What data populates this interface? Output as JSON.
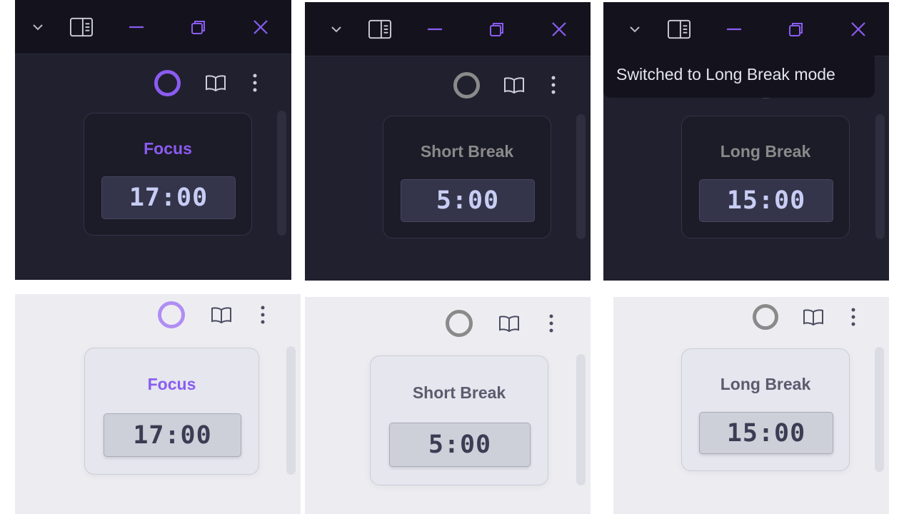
{
  "colors": {
    "accent_purple": "#8a5cf0",
    "inactive_gray": "#8a8a8a",
    "dark_bg": "#21202f",
    "light_bg": "#ededf1",
    "close_icon": "#8a5cf0"
  },
  "titlebar_icons": [
    "chevron-down-icon",
    "sidebar-toggle-icon",
    "minimize-icon",
    "restore-icon",
    "close-icon"
  ],
  "toolbar_icons": [
    "timer-ring-icon",
    "book-icon",
    "more-vertical-icon"
  ],
  "panels": [
    {
      "theme": "dark",
      "mode": "Focus",
      "time": "17:00",
      "active": true
    },
    {
      "theme": "dark",
      "mode": "Short Break",
      "time": "5:00",
      "active": false
    },
    {
      "theme": "dark",
      "mode": "Long Break",
      "time": "15:00",
      "active": false
    },
    {
      "theme": "light",
      "mode": "Focus",
      "time": "17:00",
      "active": true
    },
    {
      "theme": "light",
      "mode": "Short Break",
      "time": "5:00",
      "active": false
    },
    {
      "theme": "light",
      "mode": "Long Break",
      "time": "15:00",
      "active": false
    }
  ],
  "toast": {
    "text": "Switched to Long Break mode"
  }
}
